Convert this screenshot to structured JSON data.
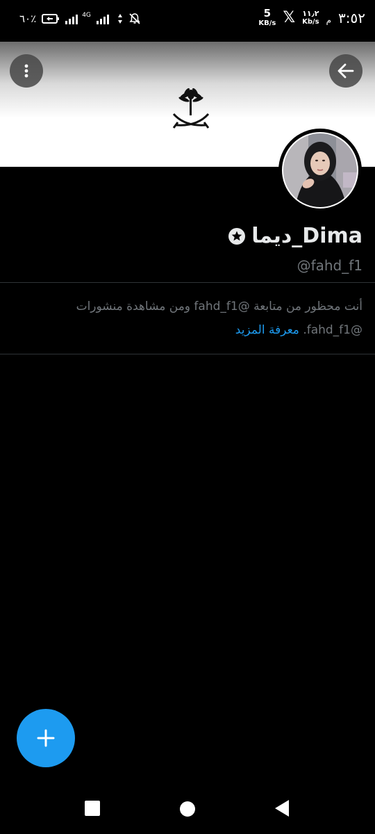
{
  "status_bar": {
    "time": "٣:٥٢",
    "am_pm": "م",
    "speed_right_value": "١١٫٢",
    "speed_right_unit": "Kb/s",
    "speed_left_value": "5",
    "speed_left_unit": "KB/s",
    "battery": "٦٠٪",
    "network": "4G"
  },
  "profile": {
    "display_name": "ديما_Dima",
    "handle": "@fahd_f1"
  },
  "notice": {
    "text": "أنت محظور من متابعة @fahd_f1 ومن مشاهدة منشورات @fahd_f1.",
    "learn_more": "معرفة المزيد"
  },
  "colors": {
    "accent": "#1d9bf0",
    "muted_text": "#71767b",
    "background": "#000000"
  },
  "icons": {
    "menu": "more-vertical-icon",
    "back": "arrow-back-icon",
    "compose": "plus-icon",
    "badge": "star-badge-icon"
  }
}
